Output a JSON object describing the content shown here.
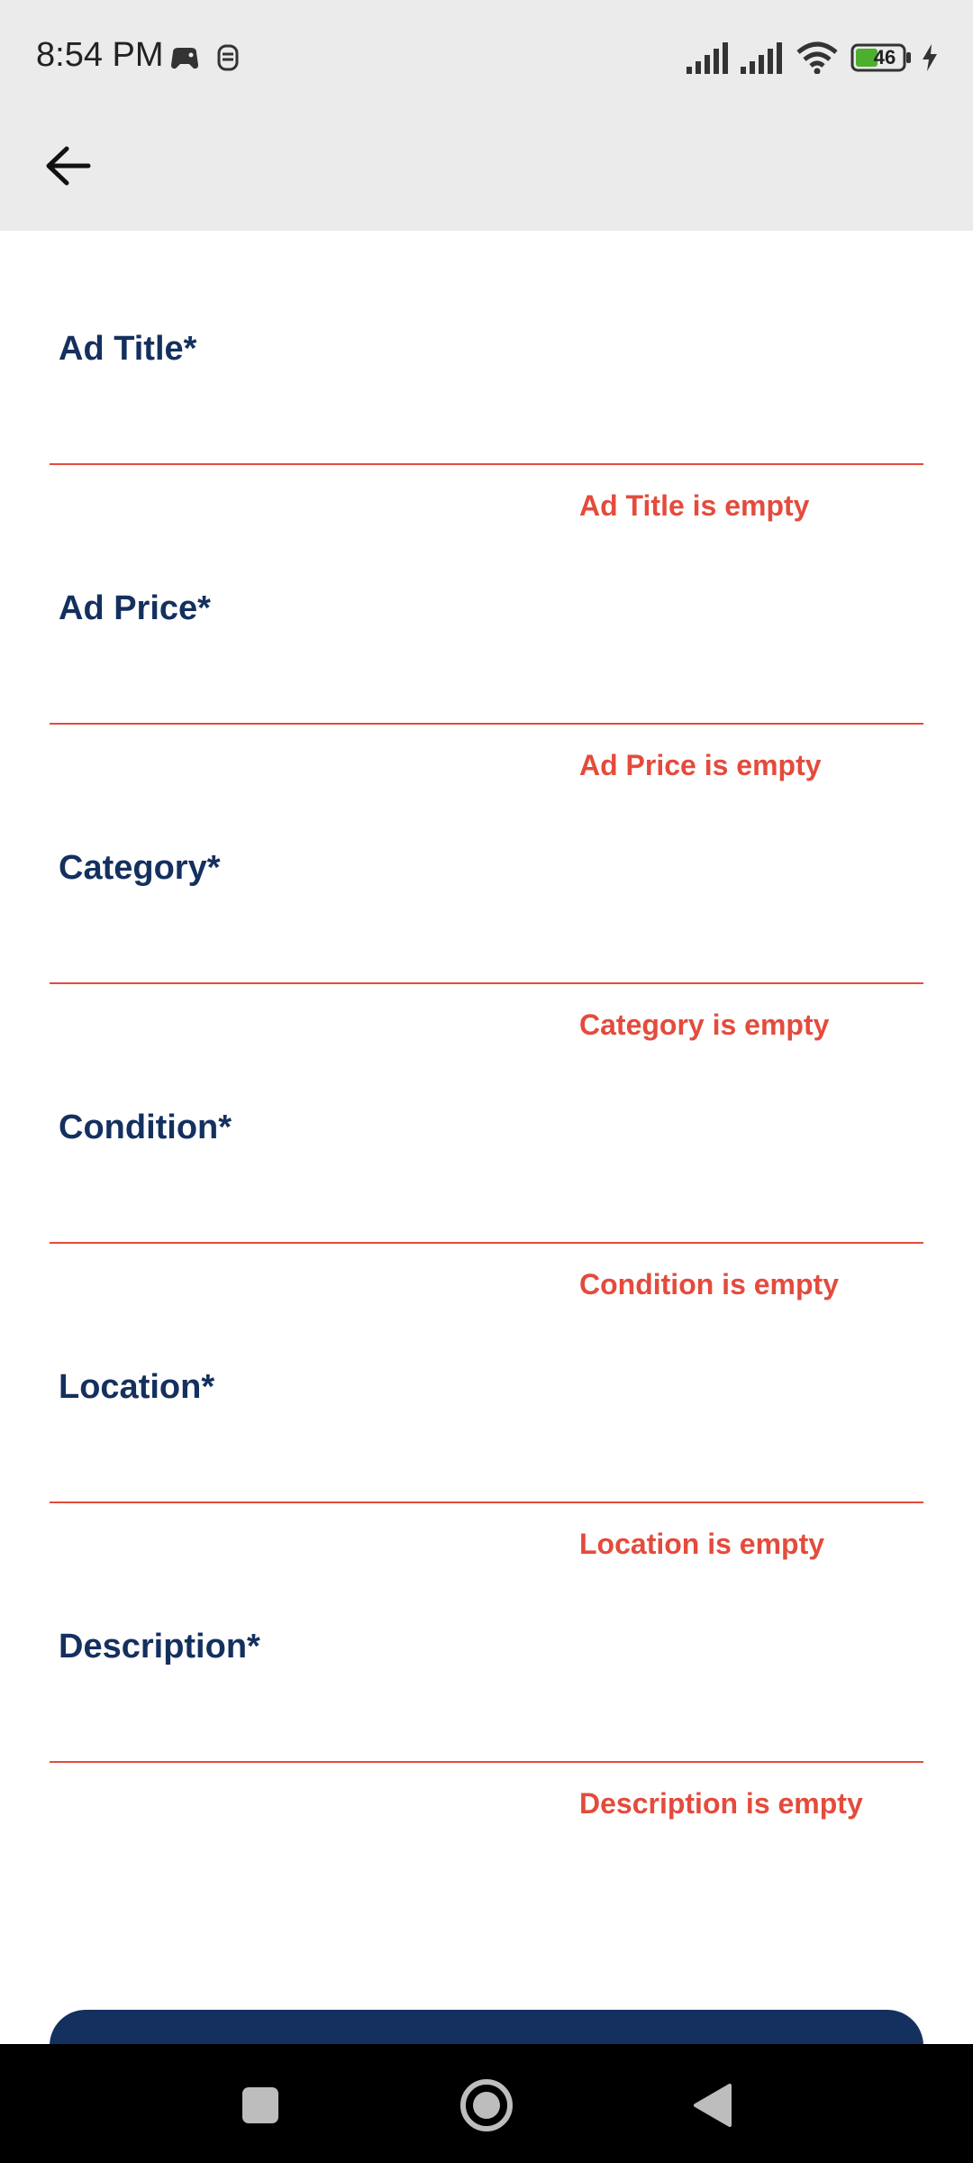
{
  "status_bar": {
    "time": "8:54 PM",
    "battery_level": "46",
    "icons": [
      "game-controller-icon",
      "notification-icon",
      "signal-icon",
      "signal-icon",
      "wifi-icon",
      "battery-icon",
      "charging-icon"
    ]
  },
  "app_bar": {
    "back_icon": "arrow-left-icon"
  },
  "form": {
    "fields": [
      {
        "label": "Ad Title*",
        "value": "",
        "error": "Ad Title is empty"
      },
      {
        "label": "Ad Price*",
        "value": "",
        "error": "Ad Price is empty"
      },
      {
        "label": "Category*",
        "value": "",
        "error": "Category is empty"
      },
      {
        "label": "Condition*",
        "value": "",
        "error": "Condition is empty"
      },
      {
        "label": "Location*",
        "value": "",
        "error": "Location is empty"
      },
      {
        "label": "Description*",
        "value": "",
        "error": "Description is empty"
      }
    ]
  },
  "colors": {
    "label": "#14305f",
    "error": "#e44b3c",
    "primary_button": "#14305f",
    "app_bar": "#ebebeb"
  },
  "nav_bar": {
    "buttons": [
      "recents-square-icon",
      "home-circle-icon",
      "back-triangle-icon"
    ]
  }
}
